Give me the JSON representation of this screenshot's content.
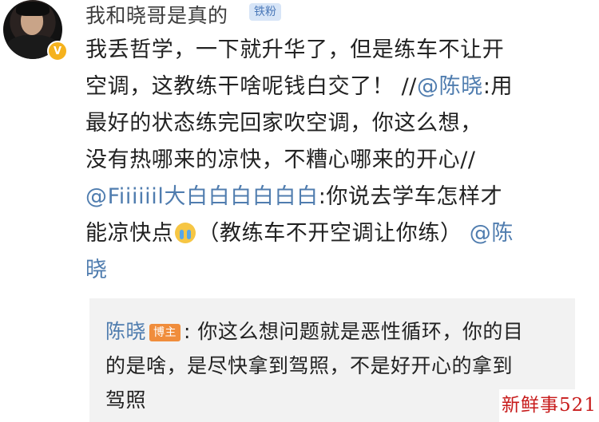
{
  "post": {
    "username": "我和晓哥是真的",
    "fan_badge": "铁粉",
    "vip_mark": "V",
    "body": {
      "line1": "我丢哲学，一下就升华了，但是练车不让开",
      "line2_text": "空调，这教练干啥呢钱白交了！",
      "line2_sep": "//",
      "line2_mention": "@陈晓",
      "line2_rest": ":用",
      "line3": "最好的状态练完回家吹空调，你这么想，",
      "line4": "没有热哪来的凉快，不糟心哪来的开心//",
      "line5_mention": "@Fiiiiiil大白白白白白白",
      "line5_rest": ":你说去学车怎样才",
      "line6_text": "能凉快点",
      "line6_rest": "（教练车不开空调让你练）",
      "line6_mention": "@陈",
      "line7_mention": "晓"
    }
  },
  "reply": {
    "author": "陈晓",
    "host_badge": "博主",
    "text_line1": ": 你这么想问题就是恶性循环，你的目",
    "text_line2": "的是啥，是尽快拿到驾照，不是好开心的拿到",
    "text_line3": "驾照"
  },
  "watermark": "新鲜事521",
  "colors": {
    "mention": "#507daf",
    "fan_badge_bg": "#d7e5f7",
    "host_badge_bg": "#f08d3c",
    "reply_bg": "#f2f2f2",
    "watermark": "#c71a1a"
  }
}
